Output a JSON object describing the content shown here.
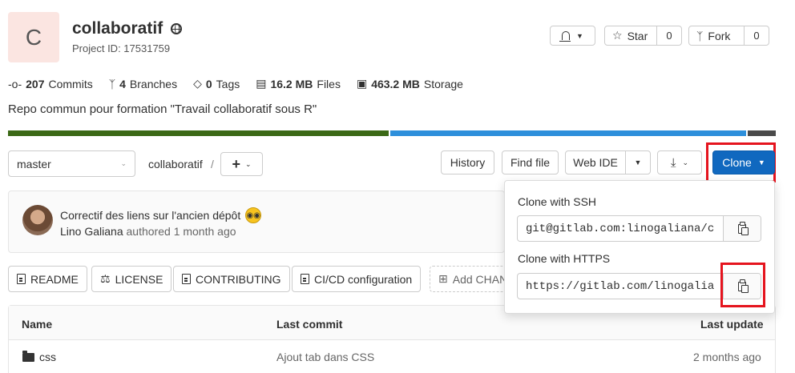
{
  "project": {
    "avatar_letter": "C",
    "name": "collaboratif",
    "id_label": "Project ID: 17531759",
    "description": "Repo commun pour formation \"Travail collaboratif sous R\""
  },
  "header_actions": {
    "star_label": "Star",
    "star_count": "0",
    "fork_label": "Fork",
    "fork_count": "0"
  },
  "stats": [
    {
      "value": "207",
      "label": "Commits",
      "icon": "commit-icon"
    },
    {
      "value": "4",
      "label": "Branches",
      "icon": "branch-icon"
    },
    {
      "value": "0",
      "label": "Tags",
      "icon": "tag-icon"
    },
    {
      "value": "16.2 MB",
      "label": "Files",
      "icon": "file-icon"
    },
    {
      "value": "463.2 MB",
      "label": "Storage",
      "icon": "storage-icon"
    }
  ],
  "language_bar_colors": [
    "#3b6916",
    "#2d8fdb",
    "#4a4a4a"
  ],
  "toolbar": {
    "branch": "master",
    "breadcrumb": "collaboratif",
    "breadcrumb_sep": "/",
    "history": "History",
    "find_file": "Find file",
    "web_ide": "Web IDE",
    "clone": "Clone"
  },
  "last_commit": {
    "message": "Correctif des liens sur l'ancien dépôt",
    "author": "Lino Galiana",
    "action": "authored",
    "time": "1 month ago"
  },
  "quick_links": [
    {
      "label": "README"
    },
    {
      "label": "LICENSE"
    },
    {
      "label": "CONTRIBUTING"
    },
    {
      "label": "CI/CD configuration"
    },
    {
      "label": "Add CHAN"
    }
  ],
  "table": {
    "headers": {
      "name": "Name",
      "last_commit": "Last commit",
      "last_update": "Last update"
    },
    "rows": [
      {
        "name": "css",
        "commit": "Ajout tab dans CSS",
        "updated": "2 months ago"
      }
    ]
  },
  "clone_panel": {
    "ssh_label": "Clone with SSH",
    "ssh_url": "git@gitlab.com:linogaliana/c",
    "https_label": "Clone with HTTPS",
    "https_url": "https://gitlab.com/linogalia"
  },
  "colors": {
    "accent": "#1068bf",
    "highlight": "#e5141e"
  }
}
